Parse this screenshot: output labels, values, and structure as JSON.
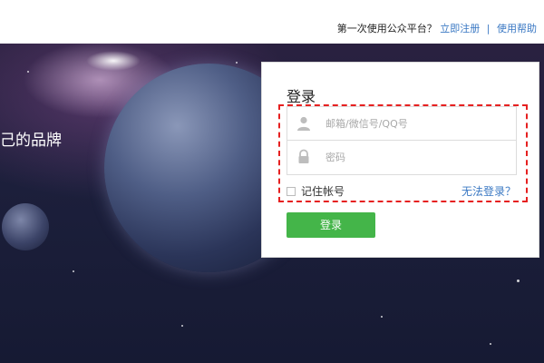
{
  "topbar": {
    "first_time_text": "第一次使用公众平台？",
    "register_link": "立即注册",
    "separator": "|",
    "help_link": "使用帮助"
  },
  "hero": {
    "slogan_text": "己的品牌"
  },
  "login": {
    "title": "登录",
    "username_placeholder": "邮箱/微信号/QQ号",
    "password_placeholder": "密码",
    "remember_label": "记住帐号",
    "forgot_link": "无法登录？",
    "submit_label": "登录"
  },
  "colors": {
    "accent_link": "#3a78c3",
    "button_green": "#44b549",
    "highlight_red": "#e62020"
  },
  "icons": {
    "username": "user-icon",
    "password": "lock-icon"
  }
}
